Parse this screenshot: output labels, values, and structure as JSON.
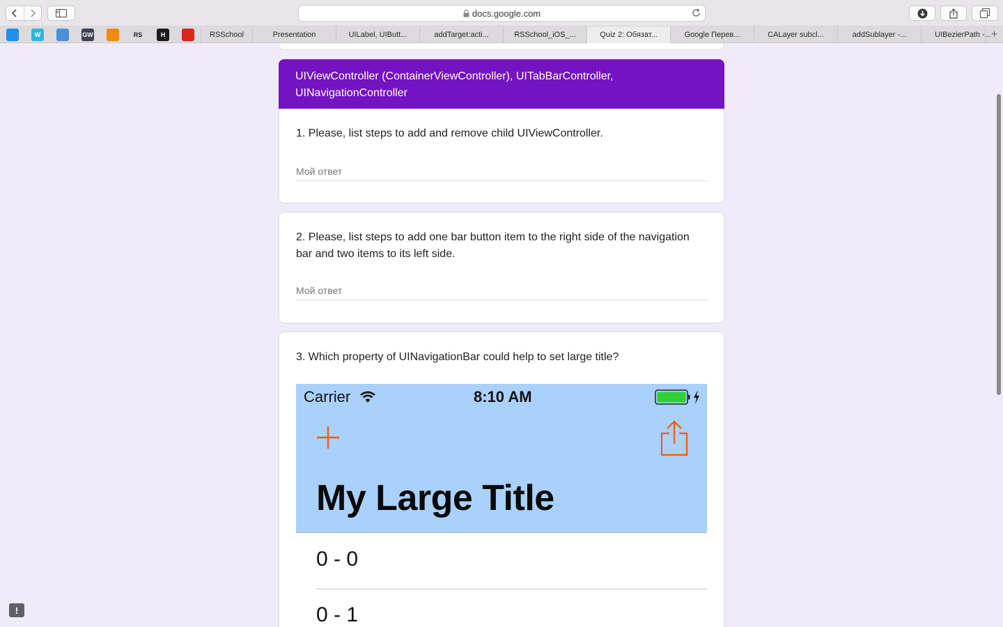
{
  "browser": {
    "url": "docs.google.com",
    "tabs": [
      {
        "label": "RSSchool",
        "active": false
      },
      {
        "label": "Presentation",
        "active": false
      },
      {
        "label": "UILabel, UIButt...",
        "active": false
      },
      {
        "label": "addTarget:acti...",
        "active": false
      },
      {
        "label": "RSSchool_iOS_...",
        "active": false
      },
      {
        "label": "Quiz 2: Обязат...",
        "active": true
      },
      {
        "label": "Google Перев...",
        "active": false
      },
      {
        "label": "CALayer subcl...",
        "active": false
      },
      {
        "label": "addSublayer -...",
        "active": false
      },
      {
        "label": "UIBezierPath -...",
        "active": false
      }
    ],
    "favorites": [
      {
        "icon": "app-store-icon",
        "color": "#1e8ff0",
        "text": ""
      },
      {
        "icon": "w-icon",
        "color": "#2bb7d9",
        "text": "W"
      },
      {
        "icon": "mail-icon",
        "color": "#4a90d9",
        "text": ""
      },
      {
        "icon": "gw-icon",
        "color": "#3f3f52",
        "text": "GW"
      },
      {
        "icon": "pause-icon",
        "color": "#f08a12",
        "text": ""
      },
      {
        "icon": "rs-icon",
        "color": "#dcdadc",
        "text": "RS"
      },
      {
        "icon": "h-icon",
        "color": "#1a1a1a",
        "text": "H"
      },
      {
        "icon": "cat-icon",
        "color": "#d9261c",
        "text": ""
      }
    ]
  },
  "form": {
    "section_title": "UIViewController (ContainerViewController), UITabBarController, UINavigationController",
    "questions": [
      {
        "text": "1. Please, list steps to add and remove child UIViewController.",
        "placeholder": "Мой ответ"
      },
      {
        "text": "2. Please, list steps to add one bar button item to the right side of the navigation bar and two items to its left side.",
        "placeholder": "Мой ответ"
      },
      {
        "text": "3. Which property of UINavigationBar could help to set large title?"
      }
    ],
    "image": {
      "carrier": "Carrier",
      "time": "8:10 AM",
      "large_title": "My Large Title",
      "cells": [
        "0 - 0",
        "0 - 1"
      ],
      "tint_color": "#f05a14",
      "battery_color": "#2fd236",
      "nav_color": "#a9d1fb"
    }
  }
}
